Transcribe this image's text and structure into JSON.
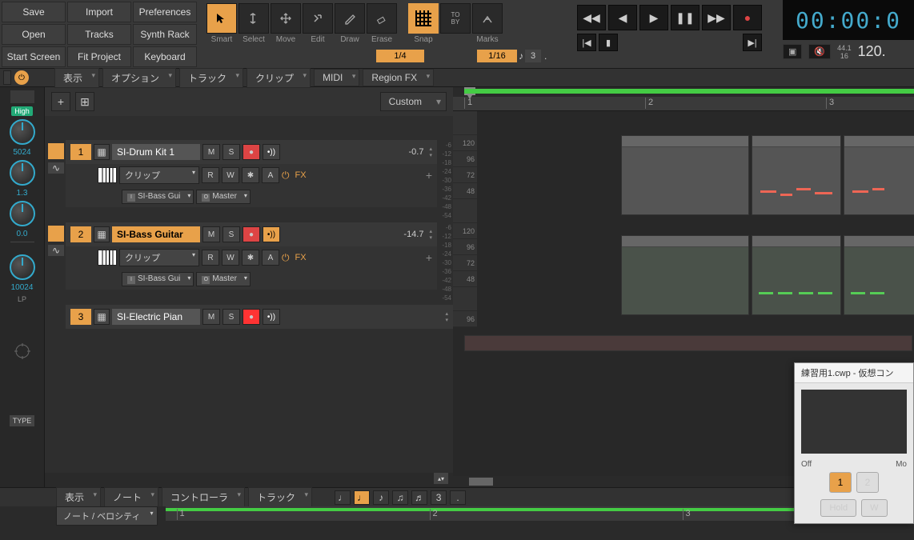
{
  "menu": {
    "save": "Save",
    "import": "Import",
    "preferences": "Preferences",
    "open": "Open",
    "tracks": "Tracks",
    "synth_rack": "Synth Rack",
    "start_screen": "Start Screen",
    "fit_project": "Fit Project",
    "keyboard": "Keyboard"
  },
  "tools": {
    "smart": "Smart",
    "select": "Select",
    "move": "Move",
    "edit": "Edit",
    "draw": "Draw",
    "erase": "Erase",
    "snap": "Snap",
    "marks": "Marks",
    "to_by": "TO\nBY"
  },
  "snap_values": {
    "primary": "1/4",
    "secondary": "1/16",
    "triplet": "3"
  },
  "transport": {
    "time": "00:00:0"
  },
  "meter": {
    "rate": "44.1",
    "bits": "16",
    "tempo": "120."
  },
  "sub": {
    "view": "表示",
    "options": "オプション",
    "track": "トラック",
    "clip": "クリップ",
    "midi": "MIDI",
    "region_fx": "Region FX"
  },
  "track_header": {
    "preset": "Custom"
  },
  "tracks": [
    {
      "num": "1",
      "name": "SI-Drum Kit 1",
      "highlight": false,
      "m": "M",
      "s": "S",
      "vol": "-0.7",
      "clip": "クリップ",
      "r": "R",
      "w": "W",
      "star": "✱",
      "a": "A",
      "fx": "FX",
      "input": "SI-Bass Gui",
      "output": "Master"
    },
    {
      "num": "2",
      "name": "SI-Bass Guitar",
      "highlight": true,
      "m": "M",
      "s": "S",
      "vol": "-14.7",
      "clip": "クリップ",
      "r": "R",
      "w": "W",
      "star": "✱",
      "a": "A",
      "fx": "FX",
      "input": "SI-Bass Gui",
      "output": "Master"
    },
    {
      "num": "3",
      "name": "SI-Electric Pian",
      "highlight": false,
      "m": "M",
      "s": "S",
      "vol": ""
    }
  ],
  "left_panel": {
    "high": "High",
    "val1": "5024",
    "val2": "1.3",
    "val3": "0.0",
    "val4": "10024",
    "lp": "LP",
    "type": "TYPE"
  },
  "db_scale": [
    "-6",
    "-12",
    "-18",
    "-24",
    "-30",
    "-36",
    "-42",
    "-48",
    "-54"
  ],
  "note_scale": [
    "120",
    "96",
    "72",
    "48"
  ],
  "ruler": [
    "1",
    "2",
    "3"
  ],
  "bottom": {
    "view": "表示",
    "note": "ノート",
    "controller": "コントローラ",
    "track": "トラック",
    "grid": "3",
    "velocity": "ノート / ベロシティ"
  },
  "floating": {
    "title": "練習用1.cwp - 仮想コン",
    "off": "Off",
    "mode": "Mo",
    "btn1": "1",
    "btn2": "2",
    "hold": "Hold",
    "w": "W"
  },
  "fx_symbol": "⏻"
}
